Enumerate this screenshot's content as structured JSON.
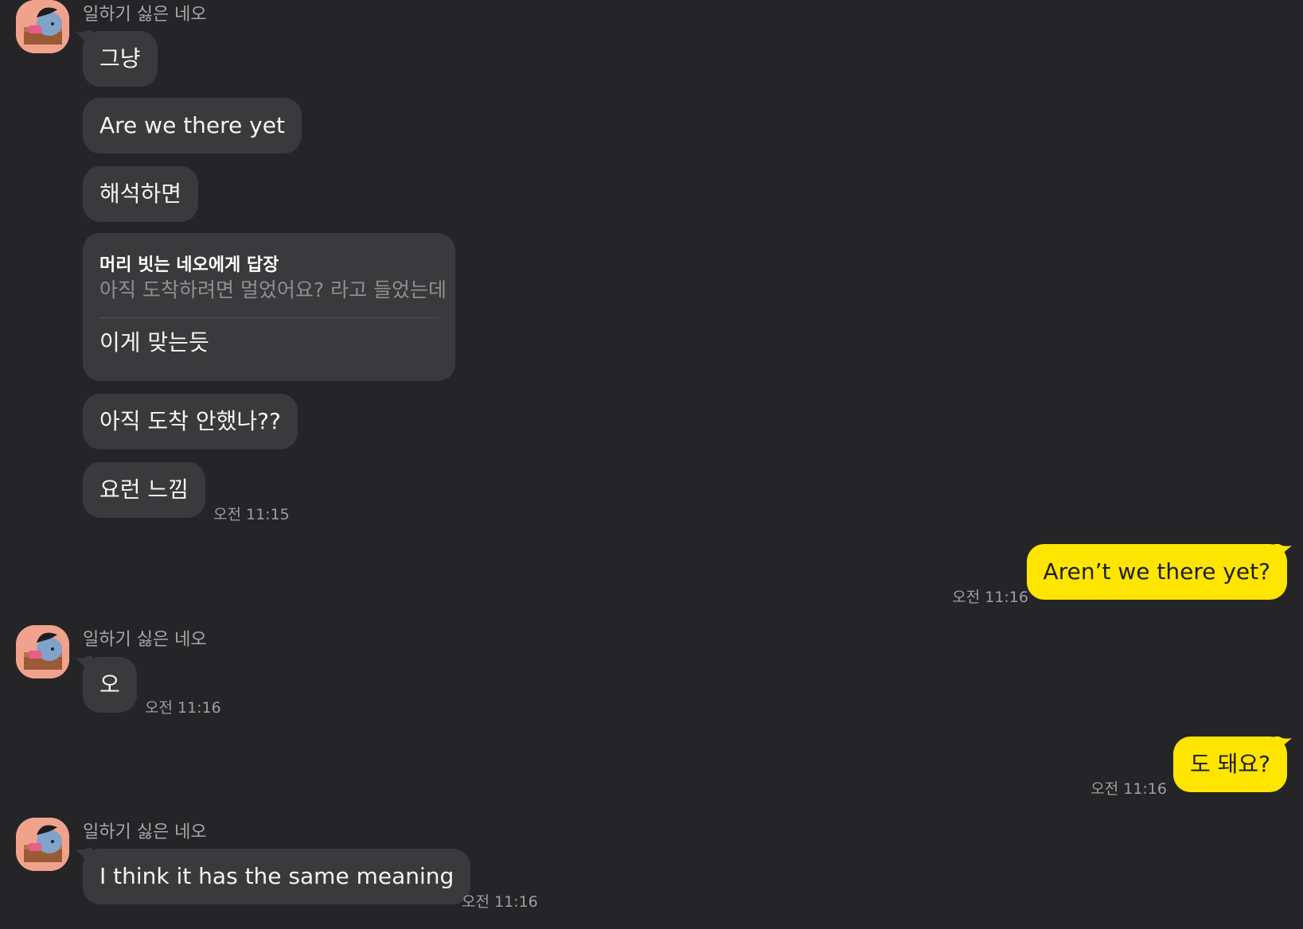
{
  "chat": {
    "groups": [
      {
        "sender": "일하기 싫은 네오",
        "avatar_icon": "neo-avatar-icon",
        "messages": [
          {
            "text": "그냥"
          },
          {
            "text": "Are we there yet"
          },
          {
            "text": "해석하면"
          },
          {
            "reply_to": "머리 빗는 네오에게 답장",
            "quoted": "아직 도착하려면 멀었어요? 라고 들었는데",
            "text": "이게 맞는듯"
          },
          {
            "text": "아직 도착 안했나??"
          },
          {
            "text": "요런 느낌",
            "time": "오전 11:15"
          }
        ]
      },
      {
        "sender": "me",
        "messages": [
          {
            "text": "Aren’t we there yet?",
            "time": "오전 11:16"
          }
        ]
      },
      {
        "sender": "일하기 싫은 네오",
        "avatar_icon": "neo-avatar-icon",
        "messages": [
          {
            "text": "오",
            "time": "오전 11:16"
          }
        ]
      },
      {
        "sender": "me",
        "messages": [
          {
            "text": "도 돼요?",
            "time": "오전 11:16"
          }
        ]
      },
      {
        "sender": "일하기 싫은 네오",
        "avatar_icon": "neo-avatar-icon",
        "messages": [
          {
            "text": "I think it has the same meaning",
            "time": "오전 11:16"
          }
        ]
      }
    ]
  },
  "colors": {
    "background": "#252527",
    "incoming_bubble": "#3a3a3c",
    "outgoing_bubble": "#fee500",
    "avatar_bg": "#f0a28c"
  }
}
